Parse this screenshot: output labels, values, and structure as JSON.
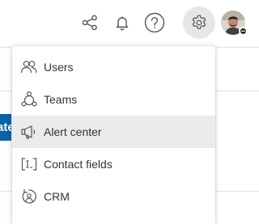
{
  "topbar": {
    "share_icon": "share-icon",
    "bell_icon": "bell-icon",
    "help_icon": "question-circle-icon",
    "settings_icon": "gear-icon",
    "avatar_status_icon": "minus-circle-icon"
  },
  "background": {
    "button_fragment": "ate"
  },
  "menu": {
    "items": [
      {
        "label": "Users",
        "icon": "users-icon"
      },
      {
        "label": "Teams",
        "icon": "teams-icon"
      },
      {
        "label": "Alert center",
        "icon": "megaphone-icon"
      },
      {
        "label": "Contact fields",
        "icon": "contact-fields-icon"
      },
      {
        "label": "CRM",
        "icon": "crm-icon"
      }
    ],
    "highlighted_index": 2
  },
  "colors": {
    "accent_blue": "#0a62a8",
    "icon_gray": "#555555",
    "highlight_bg": "#ebebeb",
    "settings_bg": "#e6e6e6"
  }
}
